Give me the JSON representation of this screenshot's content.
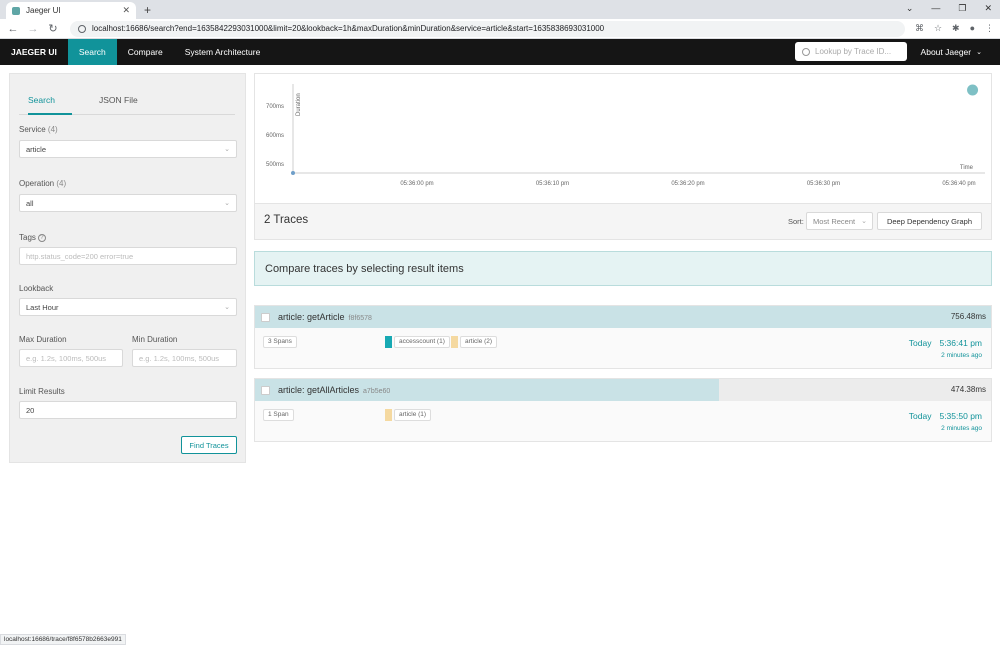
{
  "browser": {
    "tab_title": "Jaeger UI",
    "url": "localhost:16686/search?end=1635842293031000&limit=20&lookback=1h&maxDuration&minDuration&service=article&start=1635838693031000",
    "status_url": "localhost:16686/trace/f8f6578b2663e991"
  },
  "topnav": {
    "brand": "JAEGER UI",
    "items": [
      "Search",
      "Compare",
      "System Architecture"
    ],
    "lookup_placeholder": "Lookup by Trace ID...",
    "about": "About Jaeger"
  },
  "search": {
    "tabs": [
      "Search",
      "JSON File"
    ],
    "service_label": "Service",
    "service_count": "(4)",
    "service_value": "article",
    "operation_label": "Operation",
    "operation_count": "(4)",
    "operation_value": "all",
    "tags_label": "Tags",
    "tags_placeholder": "http.status_code=200 error=true",
    "lookback_label": "Lookback",
    "lookback_value": "Last Hour",
    "max_duration_label": "Max Duration",
    "min_duration_label": "Min Duration",
    "duration_placeholder": "e.g. 1.2s, 100ms, 500us",
    "limit_label": "Limit Results",
    "limit_value": "20",
    "find_button": "Find Traces"
  },
  "chart_data": {
    "type": "scatter",
    "ylabel": "Duration",
    "xlabel": "Time",
    "y_ticks": [
      "700ms",
      "600ms",
      "500ms"
    ],
    "x_ticks": [
      "05:36:00 pm",
      "05:36:10 pm",
      "05:36:20 pm",
      "05:36:30 pm",
      "05:36:40 pm"
    ],
    "points": [
      {
        "x": "05:35:50 pm",
        "y_ms": 474.38
      },
      {
        "x": "05:36:41 pm",
        "y_ms": 756.48
      }
    ],
    "colors": {
      "point": "#7ec0c5"
    }
  },
  "results": {
    "count_label": "2 Traces",
    "sort_label": "Sort:",
    "sort_value": "Most Recent",
    "ddg_button": "Deep Dependency Graph",
    "compare_banner": "Compare traces by selecting result items"
  },
  "traces": [
    {
      "name": "article: getArticle",
      "id": "f8f6578",
      "duration": "756.48ms",
      "duration_fraction": 1.0,
      "spans": "3 Spans",
      "services": [
        {
          "label": "accesscount (1)",
          "color": "#17a9b3"
        },
        {
          "label": "article (2)",
          "color": "#f5d9a0"
        }
      ],
      "day": "Today",
      "time": "5:36:41 pm",
      "ago": "2 minutes ago"
    },
    {
      "name": "article: getAllArticles",
      "id": "a7b5e60",
      "duration": "474.38ms",
      "duration_fraction": 0.63,
      "spans": "1 Span",
      "services": [
        {
          "label": "article (1)",
          "color": "#f5d9a0"
        }
      ],
      "day": "Today",
      "time": "5:35:50 pm",
      "ago": "2 minutes ago"
    }
  ]
}
